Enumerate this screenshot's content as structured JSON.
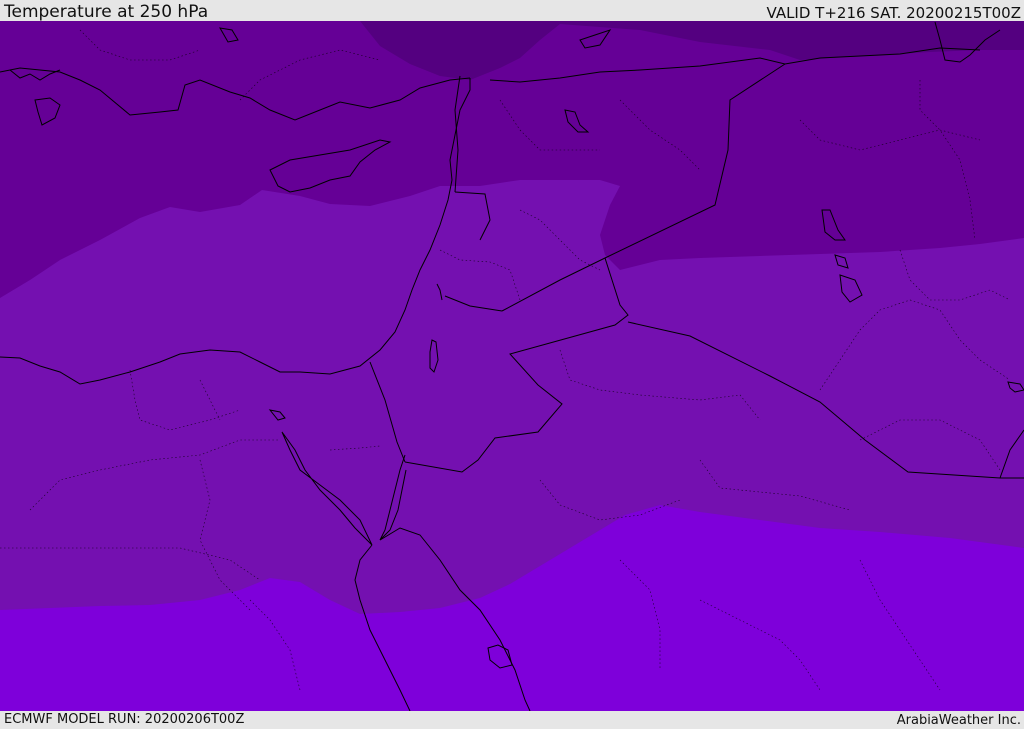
{
  "header": {
    "title": "Temperature at 250 hPa",
    "valid_time": "VALID T+216 SAT. 20200215T00Z"
  },
  "footer": {
    "model_run": "ECMWF MODEL RUN: 20200206T00Z",
    "credit": "ArabiaWeather Inc."
  },
  "colors": {
    "bands_cold_to_warm": [
      "#540080",
      "#650096",
      "#7410b0",
      "#7e00da"
    ],
    "coastline": "#000000",
    "frame": "#e6e6e6"
  }
}
